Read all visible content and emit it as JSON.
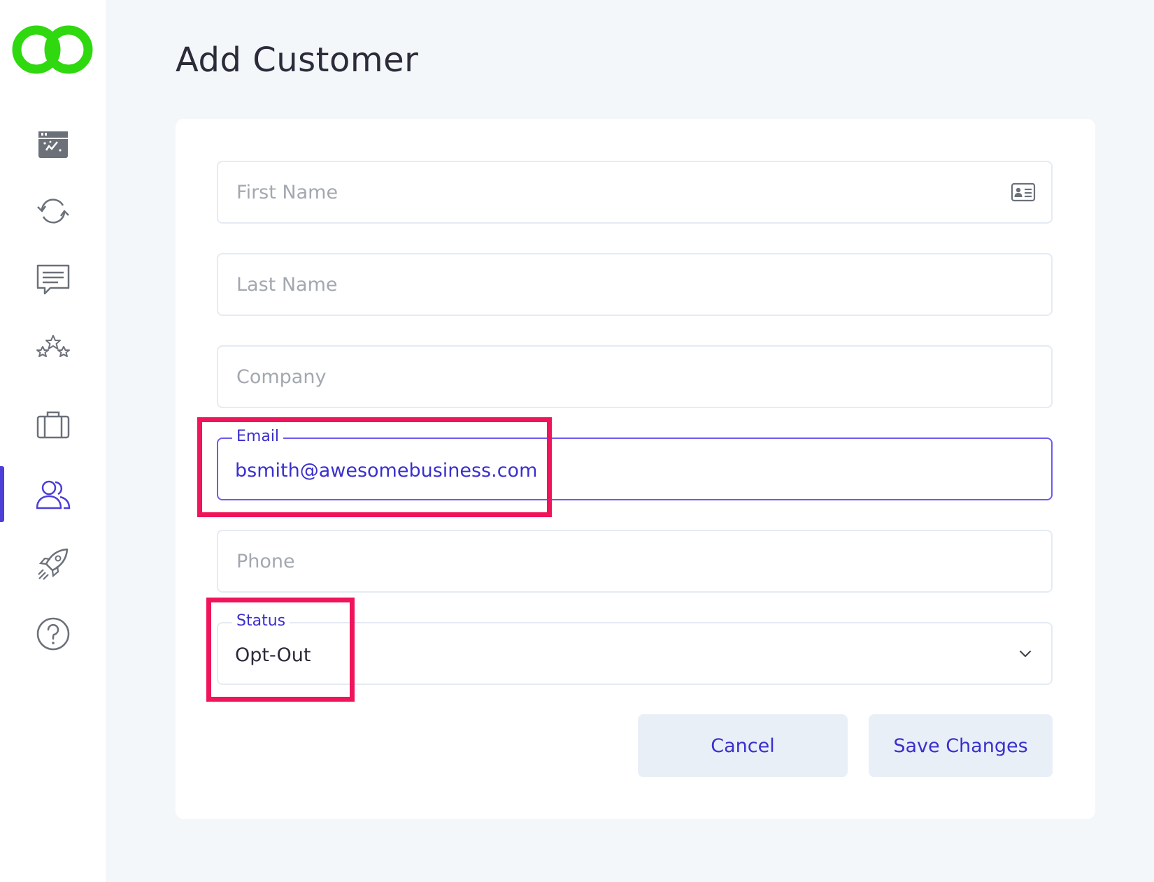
{
  "nav": {
    "items": [
      {
        "id": "dashboard",
        "icon": "dashboard-icon"
      },
      {
        "id": "sync",
        "icon": "refresh-icon"
      },
      {
        "id": "messages",
        "icon": "chat-icon"
      },
      {
        "id": "reviews",
        "icon": "stars-icon"
      },
      {
        "id": "business",
        "icon": "briefcase-icon"
      },
      {
        "id": "customers",
        "icon": "users-icon",
        "active": true
      },
      {
        "id": "launch",
        "icon": "rocket-icon"
      },
      {
        "id": "help",
        "icon": "help-icon"
      }
    ]
  },
  "page": {
    "title": "Add Customer"
  },
  "form": {
    "first_name": {
      "placeholder": "First Name",
      "value": ""
    },
    "last_name": {
      "placeholder": "Last Name",
      "value": ""
    },
    "company": {
      "placeholder": "Company",
      "value": ""
    },
    "email": {
      "label": "Email",
      "value": "bsmith@awesomebusiness.com"
    },
    "phone": {
      "placeholder": "Phone",
      "value": ""
    },
    "status": {
      "label": "Status",
      "value": "Opt-Out"
    }
  },
  "actions": {
    "cancel_label": "Cancel",
    "save_label": "Save Changes"
  },
  "colors": {
    "accent": "#3a2fcf",
    "brand_green": "#2fd80f",
    "highlight": "#f0145a",
    "icon_gray": "#6b7079"
  }
}
